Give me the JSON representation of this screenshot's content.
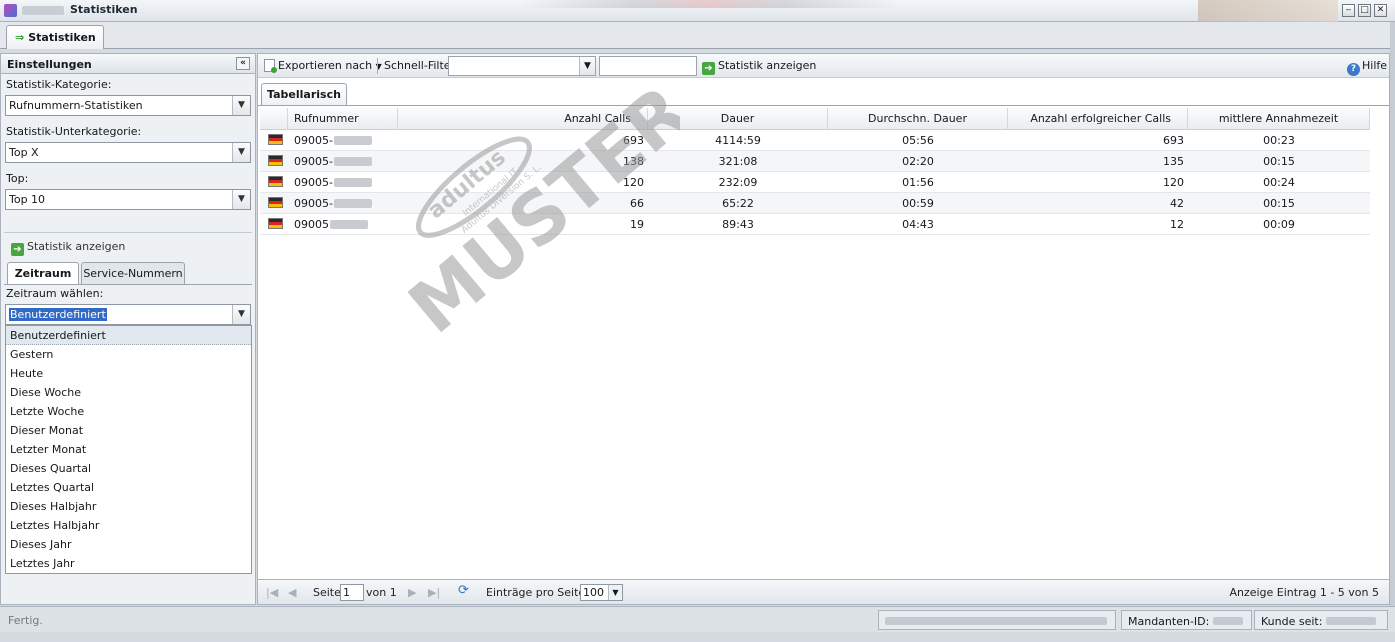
{
  "window": {
    "title": "Statistiken"
  },
  "main_tab": {
    "label": "Statistiken"
  },
  "left": {
    "header": "Einstellungen",
    "kategorie_label": "Statistik-Kategorie:",
    "kategorie_value": "Rufnummern-Statistiken",
    "unterkategorie_label": "Statistik-Unterkategorie:",
    "unterkategorie_value": "Top X",
    "top_label": "Top:",
    "top_value": "Top 10",
    "show_button": "Statistik anzeigen",
    "tabs": [
      "Zeitraum",
      "Service-Nummern"
    ],
    "zeitraum_label": "Zeitraum wählen:",
    "zeitraum_value": "Benutzerdefiniert",
    "options": [
      "Benutzerdefiniert",
      "Gestern",
      "Heute",
      "Diese Woche",
      "Letzte Woche",
      "Dieser Monat",
      "Letzter Monat",
      "Dieses Quartal",
      "Letztes Quartal",
      "Dieses Halbjahr",
      "Letztes Halbjahr",
      "Dieses Jahr",
      "Letztes Jahr"
    ]
  },
  "toolbar": {
    "export": "Exportieren nach",
    "filter_label": "Schnell-Filter",
    "show_button": "Statistik anzeigen",
    "help": "Hilfe"
  },
  "grid": {
    "tab": "Tabellarisch",
    "columns": [
      "Rufnummer",
      "Anzahl Calls",
      "Dauer",
      "Durchschn. Dauer",
      "Anzahl erfolgreicher Calls",
      "mittlere Annahmezeit"
    ],
    "rows": [
      {
        "rufnummer": "09005-",
        "calls": "693",
        "dauer": "4114:59",
        "avg": "05:56",
        "success": "693",
        "annahme": "00:23"
      },
      {
        "rufnummer": "09005-",
        "calls": "138",
        "dauer": "321:08",
        "avg": "02:20",
        "success": "135",
        "annahme": "00:15"
      },
      {
        "rufnummer": "09005-",
        "calls": "120",
        "dauer": "232:09",
        "avg": "01:56",
        "success": "120",
        "annahme": "00:24"
      },
      {
        "rufnummer": "09005-",
        "calls": "66",
        "dauer": "65:22",
        "avg": "00:59",
        "success": "42",
        "annahme": "00:15"
      },
      {
        "rufnummer": "09005",
        "calls": "19",
        "dauer": "89:43",
        "avg": "04:43",
        "success": "12",
        "annahme": "00:09"
      }
    ]
  },
  "pager": {
    "seite": "Seite",
    "page": "1",
    "von": "von 1",
    "entries_label": "Einträge pro Seite:",
    "entries_value": "100",
    "summary": "Anzeige Eintrag 1 - 5 von 5"
  },
  "status": {
    "text": "Fertig.",
    "mandant": "Mandanten-ID:",
    "kunde": "Kunde seit:"
  },
  "watermark": {
    "big": "MUSTER",
    "brand": "adultus",
    "line1": "International IT",
    "line2": "Adultus Diversion S. L."
  }
}
